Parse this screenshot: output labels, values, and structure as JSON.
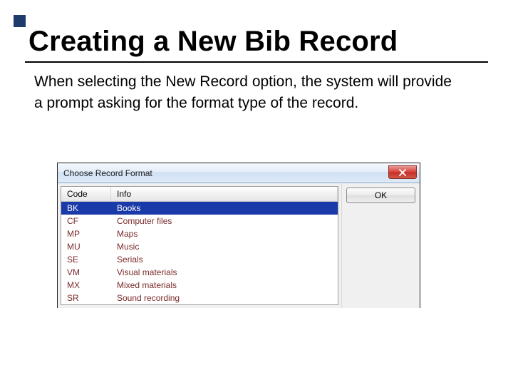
{
  "heading": "Creating a New Bib Record",
  "paragraph": "When selecting the New Record option, the system will provide a prompt asking for the format type of the record.",
  "dialog": {
    "title": "Choose Record Format",
    "ok_label": "OK",
    "columns": {
      "code": "Code",
      "info": "Info"
    },
    "rows": [
      {
        "code": "BK",
        "info": "Books",
        "selected": true
      },
      {
        "code": "CF",
        "info": "Computer files",
        "selected": false
      },
      {
        "code": "MP",
        "info": "Maps",
        "selected": false
      },
      {
        "code": "MU",
        "info": "Music",
        "selected": false
      },
      {
        "code": "SE",
        "info": "Serials",
        "selected": false
      },
      {
        "code": "VM",
        "info": "Visual materials",
        "selected": false
      },
      {
        "code": "MX",
        "info": "Mixed materials",
        "selected": false
      },
      {
        "code": "SR",
        "info": "Sound recording",
        "selected": false
      }
    ]
  }
}
